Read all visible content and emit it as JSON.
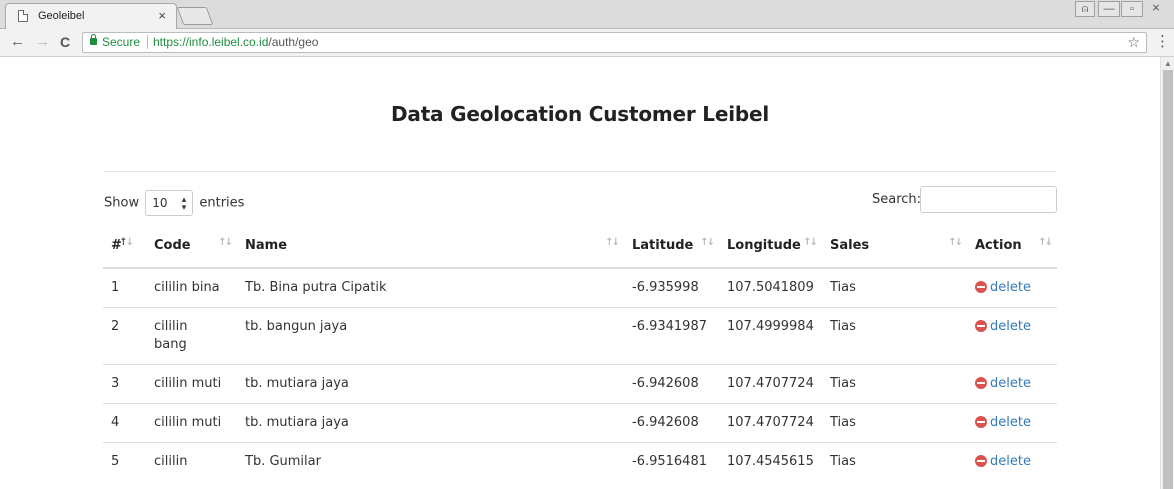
{
  "browser": {
    "tab_title": "Geoleibel",
    "tab_close": "×",
    "secure_label": "Secure",
    "url_host": "https://info.leibel.co.id",
    "url_path": "/auth/geo",
    "star": "☆",
    "menu": "⋮",
    "back": "←",
    "forward": "→",
    "reload": "C",
    "minimize": "—",
    "maximize": "▫",
    "close": "⨯",
    "profile": "⍝"
  },
  "page": {
    "title": "Data Geolocation Customer Leibel"
  },
  "controls": {
    "show_label": "Show",
    "entries_value": "10",
    "entries_label": "entries",
    "search_label": "Search:",
    "search_value": ""
  },
  "table": {
    "columns": [
      "#",
      "Code",
      "Name",
      "Latitude",
      "Longitude",
      "Sales",
      "Action"
    ],
    "rows": [
      {
        "no": "1",
        "code": "cililin bina",
        "name": "Tb. Bina putra Cipatik",
        "lat": "-6.935998",
        "lng": "107.5041809",
        "sales": "Tias",
        "action": "delete"
      },
      {
        "no": "2",
        "code": "cililin bang",
        "name": "tb. bangun jaya",
        "lat": "-6.9341987",
        "lng": "107.4999984",
        "sales": "Tias",
        "action": "delete"
      },
      {
        "no": "3",
        "code": "cililin muti",
        "name": "tb. mutiara jaya",
        "lat": "-6.942608",
        "lng": "107.4707724",
        "sales": "Tias",
        "action": "delete"
      },
      {
        "no": "4",
        "code": "cililin muti",
        "name": "tb. mutiara jaya",
        "lat": "-6.942608",
        "lng": "107.4707724",
        "sales": "Tias",
        "action": "delete"
      },
      {
        "no": "5",
        "code": "cililin",
        "name": "Tb. Gumilar",
        "lat": "-6.9516481",
        "lng": "107.4545615",
        "sales": "Tias",
        "action": "delete"
      }
    ]
  },
  "colors": {
    "link": "#337ab7",
    "delete_icon": "#d9534f",
    "secure": "#1e8e3e"
  }
}
